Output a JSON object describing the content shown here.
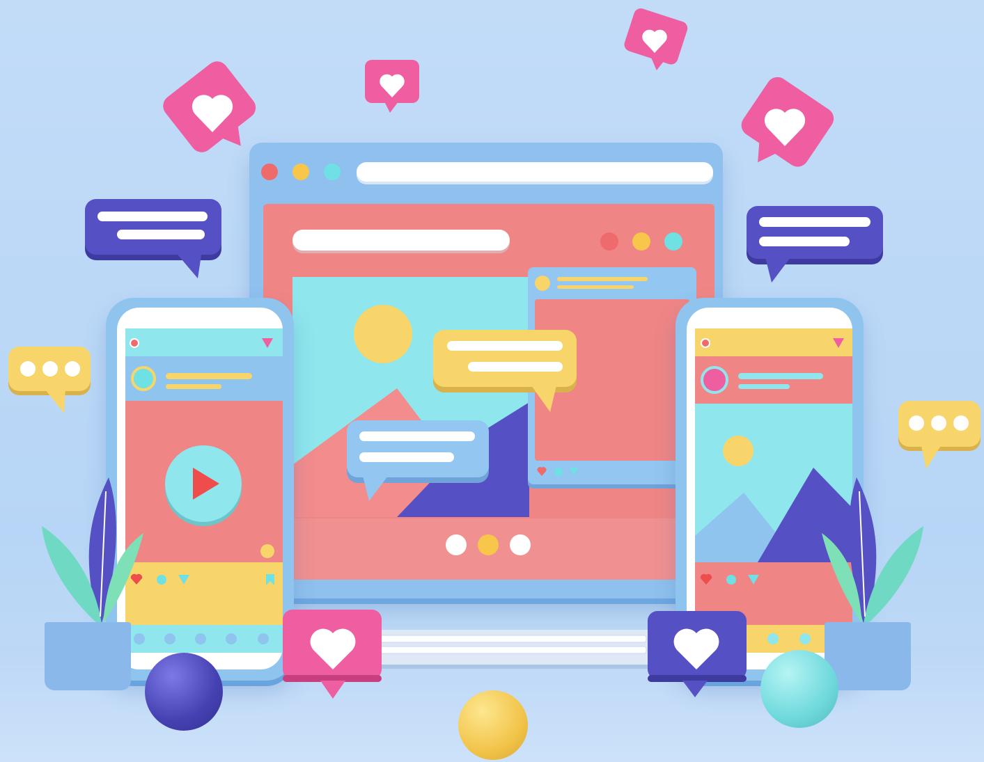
{
  "scene": {
    "description_free": true,
    "colors": {
      "background": "#bcd9f7",
      "frame_blue": "#8fc0ee",
      "coral": "#f08585",
      "cyan": "#8fe6ec",
      "yellow": "#f7d56b",
      "navy": "#5551c4",
      "pink": "#ee5ea0",
      "white": "#ffffff"
    },
    "icons": {
      "heart": "heart-icon",
      "play": "play-icon",
      "menu_dots": "ellipsis-icon",
      "chat": "chat-bubble-icon",
      "search": "search-icon",
      "bookmark": "bookmark-icon",
      "sound": "sound-icon"
    },
    "window_dots": [
      "#ef6b6b",
      "#f7c64a",
      "#6fe0e3"
    ],
    "carousel_dots": 3,
    "like_bubbles": 6,
    "text_bubbles": 4,
    "typing_bubbles": 2
  }
}
